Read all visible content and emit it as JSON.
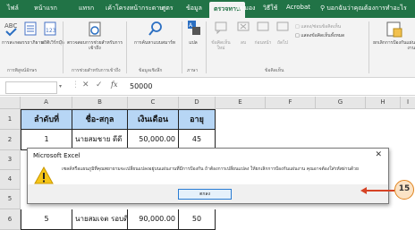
{
  "ribbon_tabs": [
    "ไฟล์",
    "หน้าแรก",
    "แทรก",
    "เค้าโครงหน้ากระดาษ",
    "สูตร",
    "ข้อมูล",
    "ตรวจทาน",
    "มุมมอง",
    "วิธีใช้",
    "Acrobat",
    "บอกฉันว่าคุณต้องการทำอะไร"
  ],
  "active_tab_index": 6,
  "ribbon": {
    "spelling": "การสะกด",
    "thesaurus": "อรรถาภิธาน",
    "stats": "สถิติเวิร์กบุ๊ก",
    "proofing_group": "การพิสูจน์อักษร",
    "accessibility": "ตรวจสอบการช่วยสำหรับการเข้าถึง",
    "accessibility_group": "การช่วยสำหรับการเข้าถึง",
    "smart_lookup": "การค้นหาแบบสมาร์ท",
    "insights_group": "ข้อมูลเชิงลึก",
    "translate": "แปล",
    "language_group": "ภาษา",
    "new_comment": "ข้อคิดเห็นใหม่",
    "delete": "ลบ",
    "previous": "ก่อนหน้า",
    "next": "ถัดไป",
    "show_comments": "แสดงข้อคิดเห็น",
    "comments_group": "ข้อคิดเห็น",
    "show_hide": "แสดง/ซ่อนข้อคิดเห็น",
    "show_all": "แสดงข้อคิดเห็นทั้งหมด",
    "protect": "ยกเลิกการป้องกันแผ่นงาน"
  },
  "formula_bar": {
    "name_box": "",
    "formula_value": "50000",
    "fx": "fx"
  },
  "grid": {
    "columns": [
      "A",
      "B",
      "C",
      "D",
      "E",
      "F",
      "G",
      "H",
      "I",
      "J"
    ],
    "rows": [
      "1",
      "2",
      "3",
      "4",
      "5",
      "6"
    ],
    "header": [
      "ลำดับที่",
      "ชื่อ-สกุล",
      "เงินเดือน",
      "อายุ"
    ],
    "data": [
      [
        "1",
        "นายสมชาย ดีดี",
        "50,000.00",
        "45"
      ],
      [
        "5",
        "นายสมเจต รอบดี",
        "90,000.00",
        "50"
      ]
    ]
  },
  "dialog": {
    "title": "Microsoft Excel",
    "message": "เซลล์หรือแผนภูมิที่คุณพยายามจะเปลี่ยนแปลงอยู่บนแผ่นงานที่มีการป้องกัน ถ้าต้องการเปลี่ยนแปลง ให้ยกเลิกการป้องกันแผ่นงาน คุณอาจต้องใส่รหัสผ่านด้วย",
    "ok_label": "ตกลง"
  },
  "callout": {
    "number": "15"
  },
  "colors": {
    "tab_bar": "#217346",
    "header_fill": "#b7d6f5",
    "callout": "#d64325"
  }
}
